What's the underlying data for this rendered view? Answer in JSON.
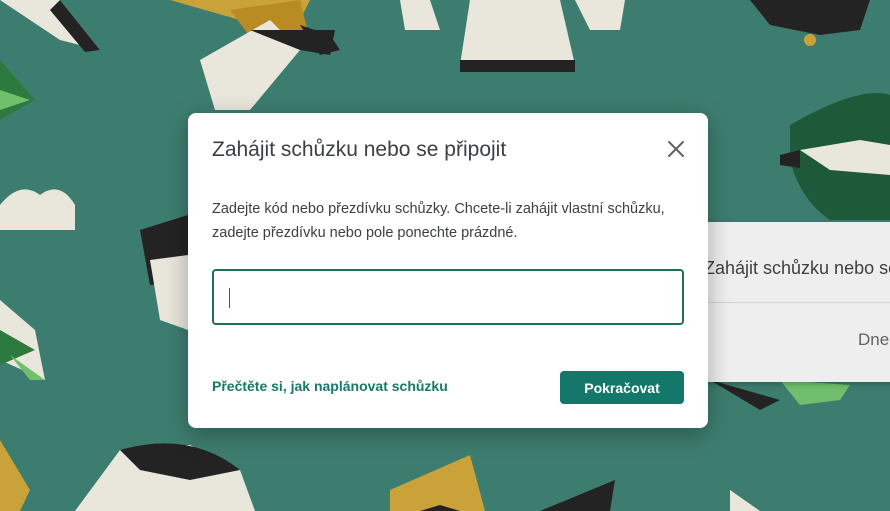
{
  "dialog": {
    "title": "Zahájit schůzku nebo se připojit",
    "description": "Zadejte kód nebo přezdívku schůzky. Chcete-li zahájit vlastní schůzku, zadejte přezdívku nebo pole ponechte prázdné.",
    "code_input": {
      "value": "",
      "placeholder": ""
    },
    "help_link": "Přečtěte si, jak naplánovat schůzku",
    "continue_button": "Pokračovat",
    "close_icon": "close-icon"
  },
  "background_card": {
    "title": "Zahájit schůzku nebo se připojit",
    "date_label": "Dne"
  },
  "colors": {
    "background": "#3d7d6f",
    "accent": "#13776a",
    "input_border": "#1e6f5f",
    "link": "#16786a"
  }
}
